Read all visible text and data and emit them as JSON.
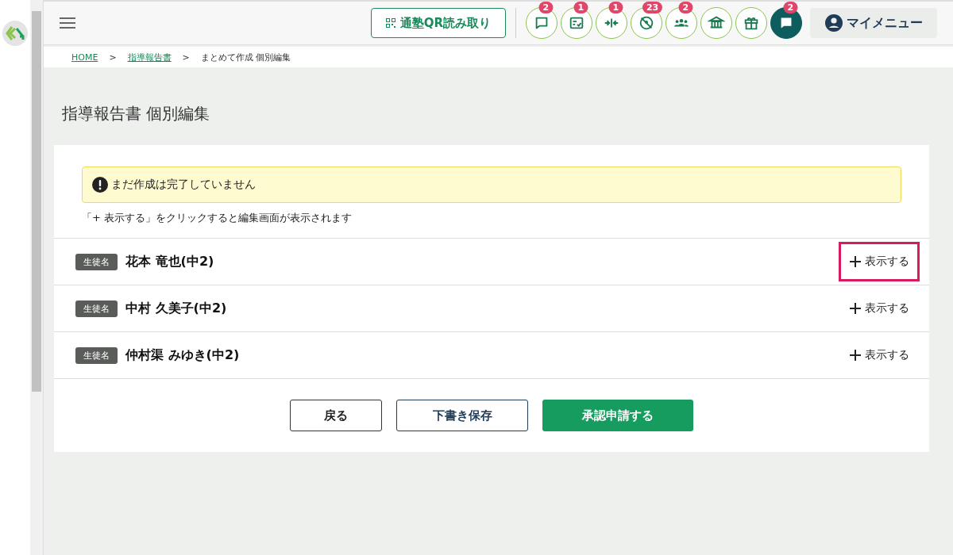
{
  "header": {
    "qr_button": "通塾QR読み取り",
    "icon_buttons": [
      {
        "badge": "2",
        "filled": false
      },
      {
        "badge": "1",
        "filled": false
      },
      {
        "badge": "1",
        "filled": false
      },
      {
        "badge": "23",
        "filled": false
      },
      {
        "badge": "2",
        "filled": false
      },
      {
        "filled": false
      },
      {
        "filled": false
      },
      {
        "badge": "2",
        "filled": true
      }
    ],
    "my_menu": "マイメニュー"
  },
  "breadcrumb": [
    {
      "label": "HOME",
      "link": true
    },
    {
      "label": "指導報告書",
      "link": true
    },
    {
      "label": "まとめて作成 個別編集",
      "link": false
    }
  ],
  "breadcrumb_separator": ">",
  "page_title": "指導報告書 個別編集",
  "alert": "まだ作成は完了していません",
  "hint": "「+ 表示する」をクリックすると編集画面が表示されます",
  "students": [
    {
      "tag": "生徒名",
      "name": "花本 竜也(中2)",
      "action": "表示する",
      "highlighted": true
    },
    {
      "tag": "生徒名",
      "name": "中村 久美子(中2)",
      "action": "表示する",
      "highlighted": false
    },
    {
      "tag": "生徒名",
      "name": "仲村渠 みゆき(中2)",
      "action": "表示する",
      "highlighted": false
    }
  ],
  "buttons": [
    {
      "label": "戻る",
      "kind": "outline-dark"
    },
    {
      "label": "下書き保存",
      "kind": "outline"
    },
    {
      "label": "承認申請する",
      "kind": "primary"
    }
  ]
}
